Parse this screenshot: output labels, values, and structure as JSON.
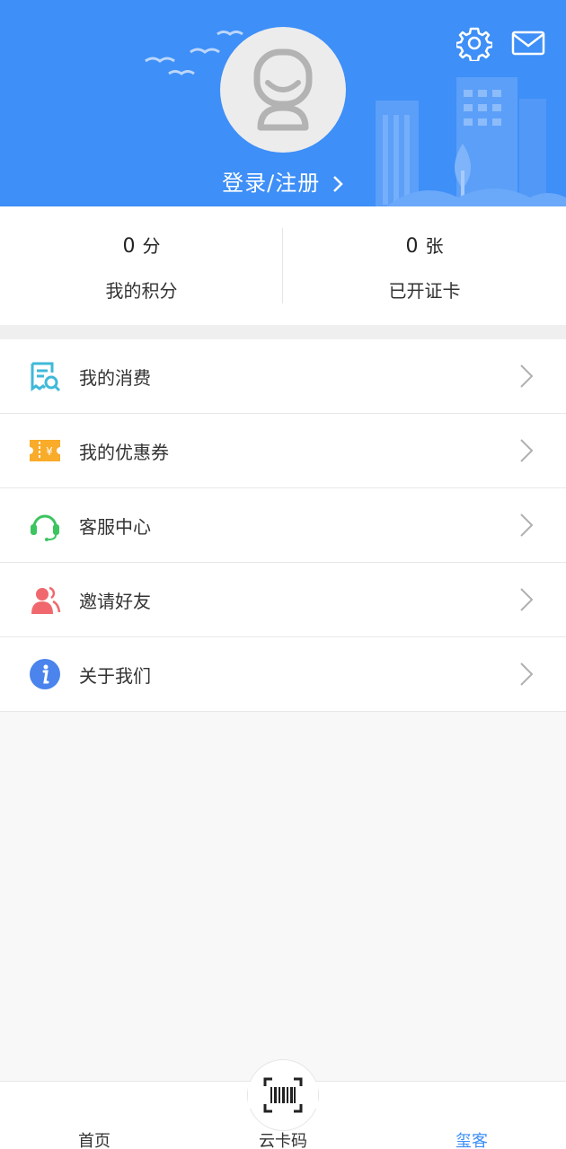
{
  "header": {
    "login_label": "登录/注册",
    "bg_color": "#3e8ff7"
  },
  "stats": [
    {
      "value": "0",
      "unit": "分",
      "label": "我的积分"
    },
    {
      "value": "0",
      "unit": "张",
      "label": "已开证卡"
    }
  ],
  "menu": [
    {
      "label": "我的消费",
      "icon": "receipt-search-icon"
    },
    {
      "label": "我的优惠券",
      "icon": "coupon-icon"
    },
    {
      "label": "客服中心",
      "icon": "headset-icon"
    },
    {
      "label": "邀请好友",
      "icon": "invite-users-icon"
    },
    {
      "label": "关于我们",
      "icon": "info-icon"
    }
  ],
  "bottom_nav": {
    "home": "首页",
    "cloud_card": "云卡码",
    "me": "玺客",
    "active_color": "#3e8ff7"
  }
}
